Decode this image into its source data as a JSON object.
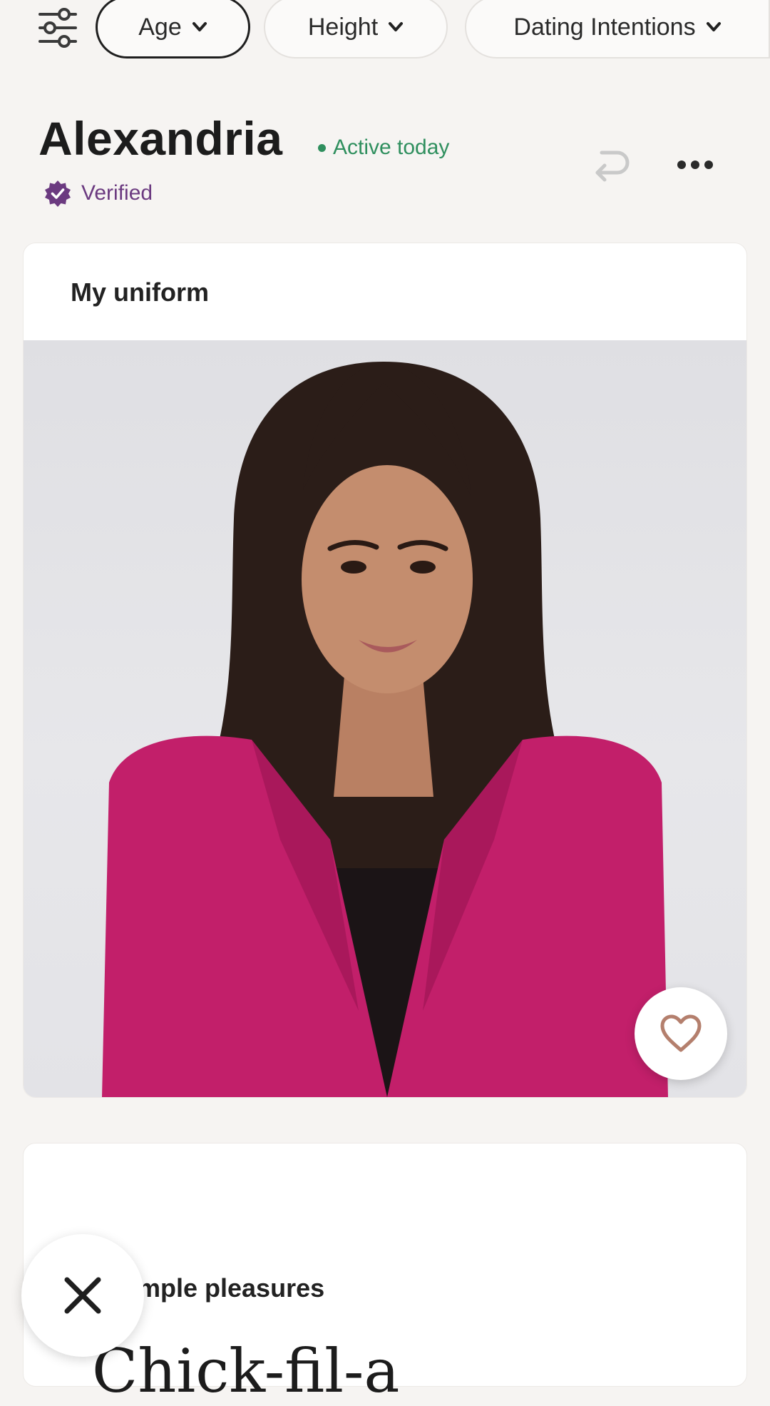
{
  "filters": {
    "age_label": "Age",
    "height_label": "Height",
    "intentions_label": "Dating Intentions"
  },
  "profile": {
    "name": "Alexandria",
    "activity": "Active today",
    "verified_label": "Verified"
  },
  "prompt_card": {
    "caption": "My uniform"
  },
  "next_card": {
    "caption": "mple pleasures",
    "answer": "Chick-fil-a"
  },
  "colors": {
    "active_green": "#2f8f5e",
    "verified_purple": "#6b3a80",
    "blazer_magenta": "#c21f6a"
  },
  "icons": {
    "filter": "sliders-icon",
    "undo": "undo-icon",
    "more": "more-icon",
    "like": "heart-icon",
    "skip": "close-icon"
  }
}
